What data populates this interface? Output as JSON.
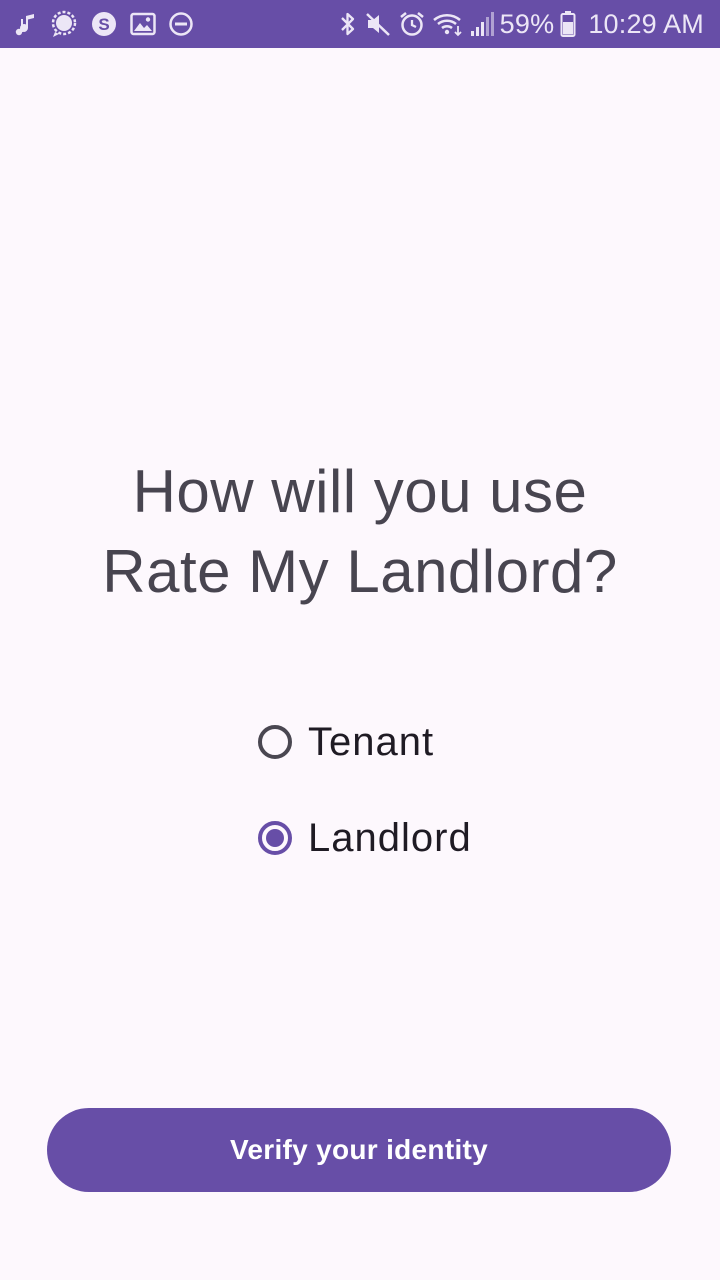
{
  "status_bar": {
    "left_icons": [
      "music-notification-icon",
      "chat-bubble-icon",
      "skype-icon",
      "image-icon",
      "do-not-disturb-icon"
    ],
    "right_icons": [
      "bluetooth-icon",
      "mute-icon",
      "alarm-icon",
      "wifi-icon",
      "signal-icon",
      "battery-icon"
    ],
    "battery_percent": "59%",
    "time": "10:29 AM",
    "background_color": "#674ea7"
  },
  "main": {
    "heading_line1": "How will you use",
    "heading_line2": "Rate My Landlord?",
    "options": [
      {
        "label": "Tenant",
        "selected": false
      },
      {
        "label": "Landlord",
        "selected": true
      }
    ]
  },
  "actions": {
    "verify_label": "Verify your identity"
  },
  "colors": {
    "accent": "#674ea7",
    "background": "#fdf8fd",
    "heading_text": "#484550",
    "label_text": "#1f1b24"
  }
}
